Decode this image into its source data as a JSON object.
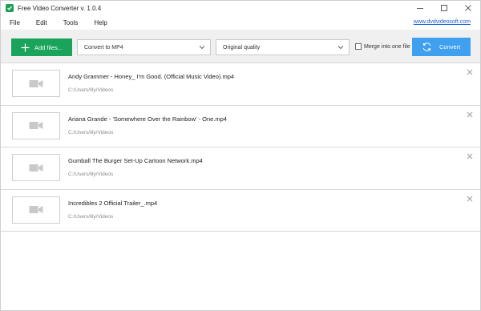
{
  "window": {
    "title": "Free Video Converter v. 1.0.4"
  },
  "menu": {
    "items": [
      "File",
      "Edit",
      "Tools",
      "Help"
    ],
    "site_link": "www.dvdvideosoft.com"
  },
  "toolbar": {
    "add_label": "Add files...",
    "format_value": "Convert to MP4",
    "quality_value": "Original quality",
    "merge_label": "Merge into one file",
    "merge_checked": false,
    "convert_label": "Convert"
  },
  "files": [
    {
      "name": "Andy Grammer - Honey_ I'm Good. (Official Music Video).mp4",
      "path": "C:/Users/lily/Videos"
    },
    {
      "name": "Ariana Grande - 'Somewhere Over the Rainbow' - One.mp4",
      "path": "C:/Users/lily/Videos"
    },
    {
      "name": "Gumball   The Burger Set-Up   Cartoon Network.mp4",
      "path": "C:/Users/lily/Videos"
    },
    {
      "name": "Incredibles 2 Official Trailer_.mp4",
      "path": "C:/Users/lily/Videos"
    }
  ],
  "colors": {
    "add_button": "#1aa35a",
    "convert_button": "#3fa0ef",
    "link": "#1a5fd6"
  },
  "icons": {
    "app": "app-logo-icon",
    "minimize": "minimize-icon",
    "maximize": "maximize-icon",
    "close": "close-icon",
    "add": "plus-icon",
    "dropdown": "chevron-down-icon",
    "convert": "refresh-icon",
    "thumbnail": "video-camera-icon",
    "remove": "remove-x-icon"
  }
}
